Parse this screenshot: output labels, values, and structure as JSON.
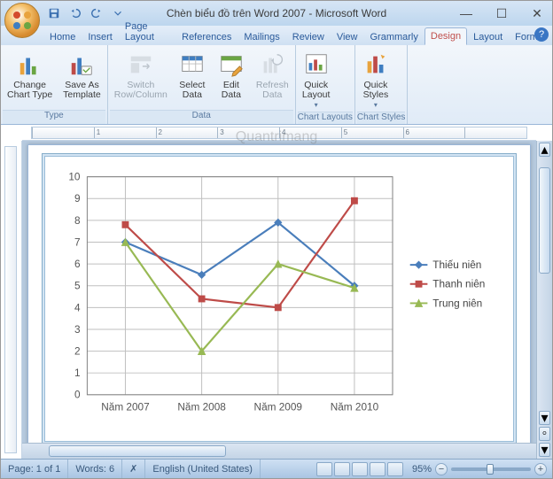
{
  "title": "Chèn biểu đồ trên Word 2007 - Microsoft Word",
  "qat": {
    "save": "save-icon",
    "undo": "undo-icon",
    "redo": "redo-icon"
  },
  "tabs": {
    "items": [
      "Home",
      "Insert",
      "Page Layout",
      "References",
      "Mailings",
      "Review",
      "View",
      "Grammarly",
      "Design",
      "Layout",
      "Format"
    ],
    "active": "Design"
  },
  "ribbon": {
    "groups": [
      {
        "label": "Type",
        "buttons": [
          {
            "name": "change-chart-type",
            "label": "Change\nChart Type"
          },
          {
            "name": "save-as-template",
            "label": "Save As\nTemplate"
          }
        ]
      },
      {
        "label": "Data",
        "buttons": [
          {
            "name": "switch-row-column",
            "label": "Switch\nRow/Column",
            "disabled": true
          },
          {
            "name": "select-data",
            "label": "Select\nData"
          },
          {
            "name": "edit-data",
            "label": "Edit\nData"
          },
          {
            "name": "refresh-data",
            "label": "Refresh\nData",
            "disabled": true
          }
        ]
      },
      {
        "label": "Chart Layouts",
        "buttons": [
          {
            "name": "quick-layout",
            "label": "Quick\nLayout",
            "dropdown": true
          }
        ]
      },
      {
        "label": "Chart Styles",
        "buttons": [
          {
            "name": "quick-styles",
            "label": "Quick\nStyles",
            "dropdown": true
          }
        ]
      }
    ]
  },
  "status": {
    "page": "Page: 1 of 1",
    "words": "Words: 6",
    "lang": "English (United States)",
    "zoom": "95%"
  },
  "watermark": "Quantrimang",
  "chart_data": {
    "type": "line",
    "categories": [
      "Năm 2007",
      "Năm 2008",
      "Năm 2009",
      "Năm 2010"
    ],
    "series": [
      {
        "name": "Thiếu niên",
        "color": "#4a7ebb",
        "marker": "diamond",
        "values": [
          7.0,
          5.5,
          7.9,
          5.0
        ]
      },
      {
        "name": "Thanh niên",
        "color": "#be4b48",
        "marker": "square",
        "values": [
          7.8,
          4.4,
          4.0,
          8.9
        ]
      },
      {
        "name": "Trung niên",
        "color": "#98b954",
        "marker": "triangle",
        "values": [
          7.0,
          2.0,
          6.0,
          4.9
        ]
      }
    ],
    "ylim": [
      0,
      10
    ],
    "yticks": [
      0,
      1,
      2,
      3,
      4,
      5,
      6,
      7,
      8,
      9,
      10
    ]
  }
}
